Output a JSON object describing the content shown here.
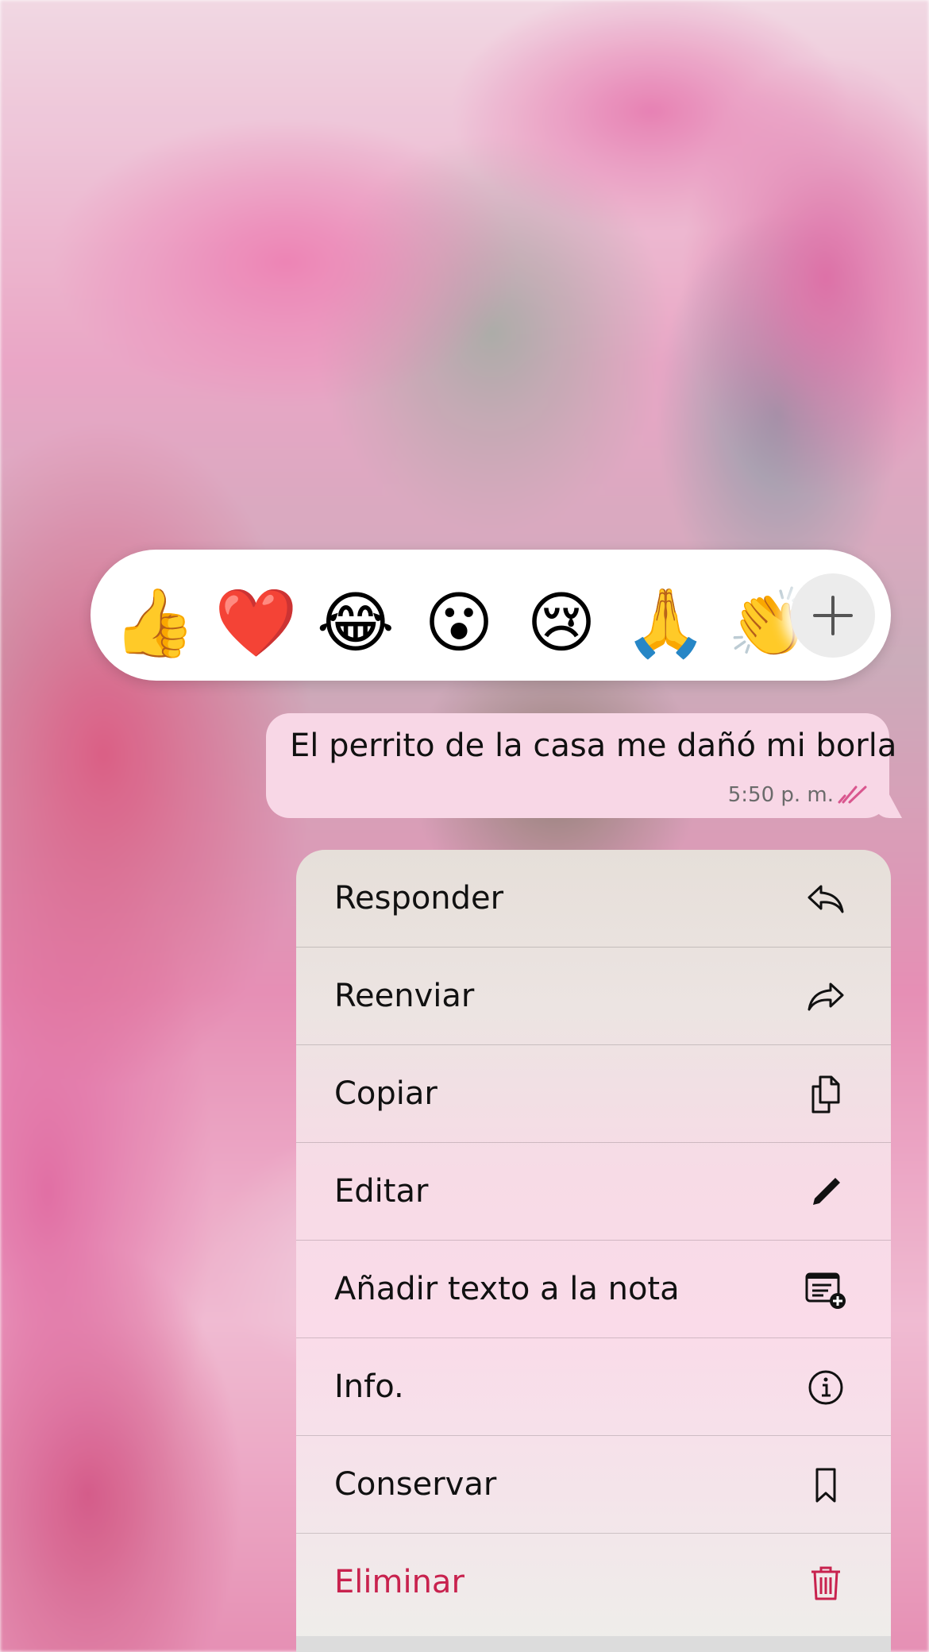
{
  "reactions": [
    {
      "emoji": "👍",
      "name": "thumbs-up"
    },
    {
      "emoji": "❤️",
      "name": "red-heart"
    },
    {
      "emoji": "😂",
      "name": "tears-of-joy"
    },
    {
      "emoji": "😮",
      "name": "surprised"
    },
    {
      "emoji": "😢",
      "name": "crying"
    },
    {
      "emoji": "🙏",
      "name": "praying-hands"
    },
    {
      "emoji": "👏",
      "name": "clapping-hands"
    }
  ],
  "more_reactions_icon": "plus-icon",
  "message": {
    "text": "El perrito de la casa me dañó mi borla",
    "time": "5:50 p. m.",
    "status_icon": "double-check-icon",
    "bubble_color": "#f8d7e6",
    "tick_color": "#d9568e"
  },
  "menu": {
    "items": [
      {
        "label": "Responder",
        "icon": "reply-icon"
      },
      {
        "label": "Reenviar",
        "icon": "forward-icon"
      },
      {
        "label": "Copiar",
        "icon": "copy-icon"
      },
      {
        "label": "Editar",
        "icon": "pencil-icon"
      },
      {
        "label": "Añadir texto a la nota",
        "icon": "add-note-icon"
      },
      {
        "label": "Info.",
        "icon": "info-icon"
      },
      {
        "label": "Conservar",
        "icon": "bookmark-icon"
      },
      {
        "label": "Eliminar",
        "icon": "trash-icon"
      }
    ],
    "danger_color": "#c8224e"
  }
}
